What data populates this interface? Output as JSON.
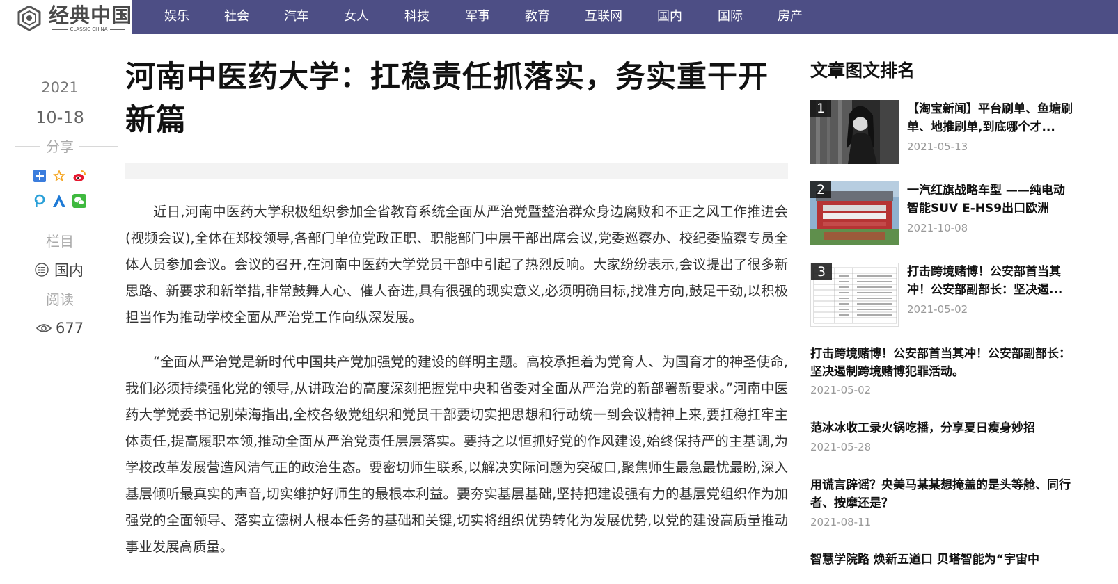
{
  "brand": {
    "name_cn": "经典中国",
    "name_en": "CLASSIC CHINA"
  },
  "nav": [
    "娱乐",
    "社会",
    "汽车",
    "女人",
    "科技",
    "军事",
    "教育",
    "互联网",
    "国内",
    "国际",
    "房产"
  ],
  "colors": {
    "nav_bg": "#4d4e85",
    "nav_text": "#ffffff"
  },
  "meta": {
    "year": "2021",
    "date": "10-18",
    "share_label": "分享",
    "share_icons": [
      "plus-share-icon",
      "star-share-icon",
      "weibo-icon",
      "p-share-icon",
      "a-share-icon",
      "wechat-icon"
    ],
    "column_label": "栏目",
    "column_value": "国内",
    "read_label": "阅读",
    "read_count": "677"
  },
  "article": {
    "title": "河南中医药大学：扛稳责任抓落实，务实重干开新篇",
    "paragraphs": [
      "近日,河南中医药大学积极组织参加全省教育系统全面从严治党暨整治群众身边腐败和不正之风工作推进会(视频会议),全体在郑校领导,各部门单位党政正职、职能部门中层干部出席会议,党委巡察办、校纪委监察专员全体人员参加会议。会议的召开,在河南中医药大学党员干部中引起了热烈反响。大家纷纷表示,会议提出了很多新思路、新要求和新举措,非常鼓舞人心、催人奋进,具有很强的现实意义,必须明确目标,找准方向,鼓足干劲,以积极担当作为推动学校全面从严治党工作向纵深发展。",
      "“全面从严治党是新时代中国共产党加强党的建设的鲜明主题。高校承担着为党育人、为国育才的神圣使命,我们必须持续强化党的领导,从讲政治的高度深刻把握党中央和省委对全面从严治党的新部署新要求。”河南中医药大学党委书记别荣海指出,全校各级党组织和党员干部要切实把思想和行动统一到会议精神上来,要扛稳扛牢主体责任,提高履职本领,推动全面从严治党责任层层落实。要持之以恒抓好党的作风建设,始终保持严的主基调,为学校改革发展营造风清气正的政治生态。要密切师生联系,以解决实际问题为突破口,聚焦师生最急最忧最盼,深入基层倾听最真实的声音,切实维护好师生的最根本利益。要夯实基层基础,坚持把建设强有力的基层党组织作为加强党的全面领导、落实立德树人根本任务的基础和关键,切实将组织优势转化为发展优势,以党的建设高质量推动事业发展高质量。"
    ]
  },
  "sidebar": {
    "title": "文章图文排名",
    "ranked": [
      {
        "rank": "1",
        "title": "【淘宝新闻】平台刷单、鱼塘刷单、地推刷单,到底哪个才...",
        "date": "2021-05-13"
      },
      {
        "rank": "2",
        "title": "一汽红旗战略车型 ——纯电动智能SUV E-HS9出口欧洲",
        "date": "2021-10-08"
      },
      {
        "rank": "3",
        "title": "打击跨境赌博！公安部首当其冲！公安部副部长：坚决遏...",
        "date": "2021-05-02"
      }
    ],
    "items": [
      {
        "title": "打击跨境赌博！公安部首当其冲！公安部副部长：坚决遏制跨境赌博犯罪活动。",
        "date": "2021-05-02"
      },
      {
        "title": "范冰冰收工录火锅吃播，分享夏日瘦身妙招",
        "date": "2021-05-28"
      },
      {
        "title": "用谎言辟谣？央美马某某想掩盖的是头等舱、同行者、按摩还是？",
        "date": "2021-08-11"
      },
      {
        "title": "智慧学院路 焕新五道口 贝塔智能为“宇宙中",
        "date": ""
      }
    ]
  }
}
